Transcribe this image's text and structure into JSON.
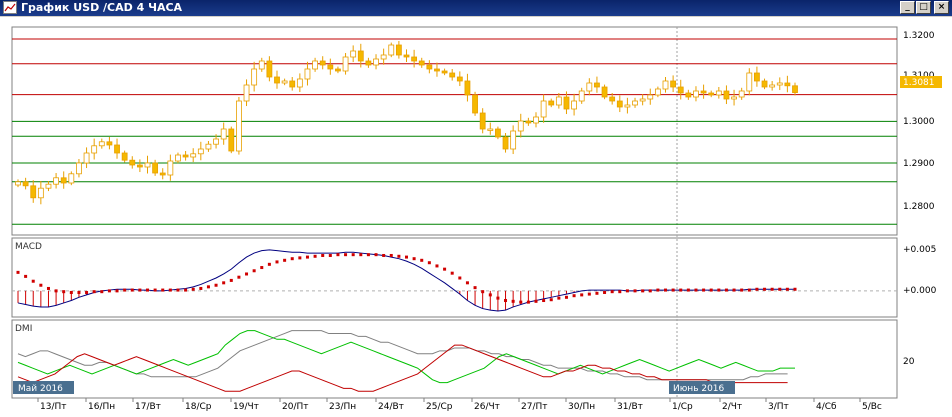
{
  "window": {
    "title": "График USD /CAD  4 ЧАСА",
    "btn_minimize": "_",
    "btn_restore": "□",
    "btn_close": "×",
    "icon": "chart-window-icon"
  },
  "colors": {
    "candle_up": "#f5b800",
    "candle_down": "#e8a000",
    "resistance": "#c00000",
    "support": "#008000",
    "macd_line": "#000080",
    "macd_signal": "#d00000",
    "dmi_plus": "#00c000",
    "dmi_minus": "#c00000",
    "adx": "#808080",
    "price_tag": "#f5b800",
    "date_tag": "#4a6f8f"
  },
  "price_panel": {
    "current_price_label": "1.3081",
    "partial_tick_label": "1.3100",
    "y_ticks": [
      "1.3200",
      "1.3000",
      "1.2900",
      "1.2800"
    ]
  },
  "macd_panel": {
    "label": "MACD",
    "y_ticks": [
      "+0.005",
      "+0.000"
    ]
  },
  "dmi_panel": {
    "label": "DMI",
    "y_ticks": [
      "20"
    ],
    "month_tags": [
      "Май 2016",
      "Июнь 2016"
    ]
  },
  "x_axis": {
    "labels": [
      "13/Пт",
      "16/Пн",
      "17/Вт",
      "18/Ср",
      "19/Чт",
      "20/Пт",
      "23/Пн",
      "24/Вт",
      "25/Ср",
      "26/Чт",
      "27/Пт",
      "30/Пн",
      "31/Вт",
      "1/Ср",
      "2/Чт",
      "3/Пт",
      "4/Сб",
      "5/Вс"
    ]
  },
  "chart_data": {
    "type": "candlestick",
    "symbol": "USD/CAD",
    "timeframe": "4 ЧАСА",
    "ylim": [
      1.273,
      1.324
    ],
    "horizontal_levels": {
      "resistance": [
        1.3215,
        1.3153,
        1.3076
      ],
      "support": [
        1.3009,
        1.2972,
        1.2905,
        1.2858,
        1.2752
      ]
    },
    "close_series": [
      1.2858,
      1.2848,
      1.2818,
      1.2842,
      1.2852,
      1.2868,
      1.2855,
      1.2878,
      1.2905,
      1.293,
      1.2948,
      1.2958,
      1.295,
      1.293,
      1.2912,
      1.29,
      1.2895,
      1.2905,
      1.288,
      1.2875,
      1.291,
      1.2925,
      1.292,
      1.2928,
      1.294,
      1.2952,
      1.2965,
      1.299,
      1.2935,
      1.306,
      1.31,
      1.314,
      1.316,
      1.312,
      1.3105,
      1.311,
      1.3095,
      1.3115,
      1.314,
      1.316,
      1.315,
      1.314,
      1.3135,
      1.317,
      1.3185,
      1.316,
      1.315,
      1.3165,
      1.3175,
      1.32,
      1.3175,
      1.317,
      1.316,
      1.315,
      1.314,
      1.3135,
      1.313,
      1.312,
      1.311,
      1.3075,
      1.303,
      1.299,
      1.299,
      1.297,
      1.294,
      1.2985,
      1.301,
      1.3005,
      1.302,
      1.306,
      1.305,
      1.307,
      1.304,
      1.306,
      1.3085,
      1.3105,
      1.3095,
      1.307,
      1.306,
      1.3045,
      1.305,
      1.306,
      1.3065,
      1.3075,
      1.309,
      1.311,
      1.3095,
      1.308,
      1.307,
      1.3085,
      1.308,
      1.3075,
      1.3085,
      1.3065,
      1.307,
      1.3085,
      1.313,
      1.311,
      1.3095,
      1.31,
      1.3105,
      1.3098,
      1.3081
    ],
    "macd": {
      "main": [
        -0.0015,
        -0.0017,
        -0.0019,
        -0.002,
        -0.002,
        -0.0018,
        -0.0015,
        -0.0012,
        -0.0008,
        -0.0005,
        -0.0002,
        0.0,
        0.0001,
        0.0002,
        0.0002,
        0.0002,
        0.0001,
        0.0001,
        0.0,
        0.0,
        0.0001,
        0.0002,
        0.0003,
        0.0005,
        0.0008,
        0.0012,
        0.0016,
        0.0021,
        0.0027,
        0.0035,
        0.0042,
        0.0047,
        0.005,
        0.0051,
        0.005,
        0.0049,
        0.0048,
        0.0048,
        0.0047,
        0.0047,
        0.0047,
        0.0047,
        0.0047,
        0.0048,
        0.0048,
        0.0047,
        0.0046,
        0.0045,
        0.0044,
        0.0042,
        0.004,
        0.0037,
        0.0033,
        0.0028,
        0.0022,
        0.0016,
        0.001,
        0.0003,
        -0.0004,
        -0.0012,
        -0.0018,
        -0.0022,
        -0.0024,
        -0.0025,
        -0.0024,
        -0.002,
        -0.0017,
        -0.0014,
        -0.0012,
        -0.001,
        -0.0008,
        -0.0006,
        -0.0004,
        -0.0002,
        0.0,
        0.0001,
        0.0001,
        0.0001,
        0.0001,
        0.0001,
        0.0,
        0.0,
        0.0001,
        0.0001,
        0.0001,
        0.0001,
        0.0001,
        0.0001,
        0.0001,
        0.0001,
        0.0001,
        0.0001,
        0.0001,
        0.0001,
        0.0001,
        0.0001,
        0.0002,
        0.0002,
        0.0002,
        0.0002,
        0.0002,
        0.0002,
        0.0002
      ],
      "signal": [
        0.0023,
        0.0018,
        0.0012,
        0.0007,
        0.0003,
        0.0,
        -0.0001,
        -0.0002,
        -0.0002,
        -0.0002,
        -0.0001,
        -0.0001,
        0.0,
        0.0,
        0.0001,
        0.0001,
        0.0001,
        0.0001,
        0.0001,
        0.0001,
        0.0001,
        0.0001,
        0.0001,
        0.0002,
        0.0003,
        0.0005,
        0.0007,
        0.001,
        0.0013,
        0.0017,
        0.0021,
        0.0025,
        0.0029,
        0.0033,
        0.0036,
        0.0038,
        0.004,
        0.0041,
        0.0042,
        0.0043,
        0.0044,
        0.0044,
        0.0045,
        0.0045,
        0.0045,
        0.0045,
        0.0045,
        0.0045,
        0.0044,
        0.0044,
        0.0043,
        0.0042,
        0.004,
        0.0038,
        0.0035,
        0.0031,
        0.0027,
        0.0022,
        0.0016,
        0.001,
        0.0004,
        -0.0001,
        -0.0005,
        -0.0009,
        -0.0012,
        -0.0013,
        -0.0014,
        -0.0014,
        -0.0013,
        -0.0012,
        -0.0011,
        -0.0009,
        -0.0008,
        -0.0006,
        -0.0005,
        -0.0004,
        -0.0003,
        -0.0002,
        -0.0001,
        -0.0001,
        0.0,
        0.0,
        0.0,
        0.0,
        0.0001,
        0.0001,
        0.0001,
        0.0001,
        0.0001,
        0.0001,
        0.0001,
        0.0001,
        0.0001,
        0.0001,
        0.0001,
        0.0001,
        0.0001,
        0.0002,
        0.0002,
        0.0002,
        0.0002,
        0.0002,
        0.0002
      ]
    },
    "dmi": {
      "plus_di": [
        22,
        21,
        20,
        19,
        18,
        19,
        20,
        21,
        20,
        19,
        18,
        19,
        20,
        21,
        20,
        19,
        18,
        19,
        20,
        21,
        22,
        23,
        22,
        21,
        22,
        23,
        24,
        25,
        28,
        30,
        32,
        33,
        33,
        32,
        31,
        30,
        30,
        29,
        28,
        27,
        26,
        25,
        26,
        27,
        28,
        29,
        28,
        27,
        26,
        25,
        24,
        23,
        22,
        21,
        20,
        18,
        16,
        15,
        15,
        16,
        17,
        18,
        19,
        20,
        22,
        24,
        25,
        24,
        23,
        22,
        21,
        20,
        19,
        18,
        19,
        20,
        21,
        20,
        19,
        18,
        19,
        20,
        21,
        22,
        23,
        22,
        21,
        20,
        19,
        20,
        21,
        22,
        23,
        22,
        21,
        20,
        21,
        22,
        21,
        20,
        19,
        19,
        19,
        20,
        20,
        20
      ],
      "minus_di": [
        17,
        16,
        15,
        16,
        17,
        18,
        20,
        22,
        24,
        25,
        24,
        23,
        22,
        21,
        22,
        23,
        24,
        23,
        22,
        21,
        20,
        19,
        18,
        17,
        16,
        15,
        14,
        13,
        12,
        12,
        12,
        13,
        14,
        15,
        16,
        17,
        18,
        19,
        19,
        18,
        17,
        16,
        15,
        14,
        13,
        13,
        12,
        12,
        12,
        13,
        14,
        15,
        16,
        17,
        18,
        20,
        22,
        24,
        26,
        28,
        28,
        27,
        26,
        25,
        24,
        23,
        22,
        21,
        20,
        19,
        18,
        17,
        17,
        18,
        19,
        19,
        20,
        21,
        21,
        20,
        20,
        19,
        19,
        18,
        18,
        17,
        17,
        16,
        16,
        16,
        16,
        16,
        16,
        16,
        15,
        15,
        15,
        15,
        15,
        15,
        15,
        15,
        15,
        15,
        15
      ],
      "adx": [
        25,
        24,
        25,
        26,
        26,
        25,
        24,
        23,
        22,
        21,
        21,
        22,
        22,
        21,
        20,
        19,
        18,
        18,
        17,
        17,
        17,
        17,
        17,
        17,
        17,
        18,
        19,
        20,
        22,
        24,
        26,
        27,
        28,
        29,
        30,
        31,
        32,
        33,
        33,
        33,
        33,
        33,
        32,
        32,
        32,
        32,
        31,
        31,
        30,
        29,
        29,
        28,
        27,
        26,
        25,
        25,
        25,
        26,
        26,
        27,
        27,
        27,
        26,
        26,
        25,
        25,
        24,
        24,
        23,
        23,
        22,
        21,
        21,
        20,
        20,
        20,
        20,
        19,
        19,
        19,
        18,
        18,
        17,
        17,
        17,
        16,
        16,
        16,
        16,
        16,
        16,
        16,
        16,
        16,
        16,
        16,
        16,
        16,
        16,
        17,
        17,
        18,
        18,
        18,
        18
      ]
    }
  }
}
